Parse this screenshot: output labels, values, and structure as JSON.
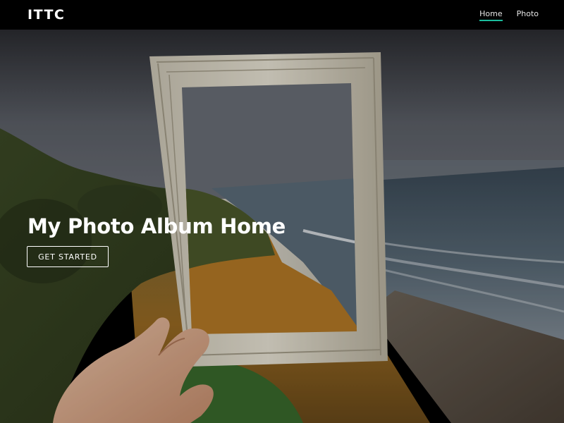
{
  "navbar": {
    "brand": "ITTC",
    "links": [
      {
        "label": "Home",
        "active": true
      },
      {
        "label": "Photo",
        "active": false
      }
    ],
    "accent_color": "#1abc9c"
  },
  "hero": {
    "title": "My Photo Album Home",
    "cta_label": "GET STARTED",
    "image_icon": "coast-with-picture-frame-photo"
  }
}
